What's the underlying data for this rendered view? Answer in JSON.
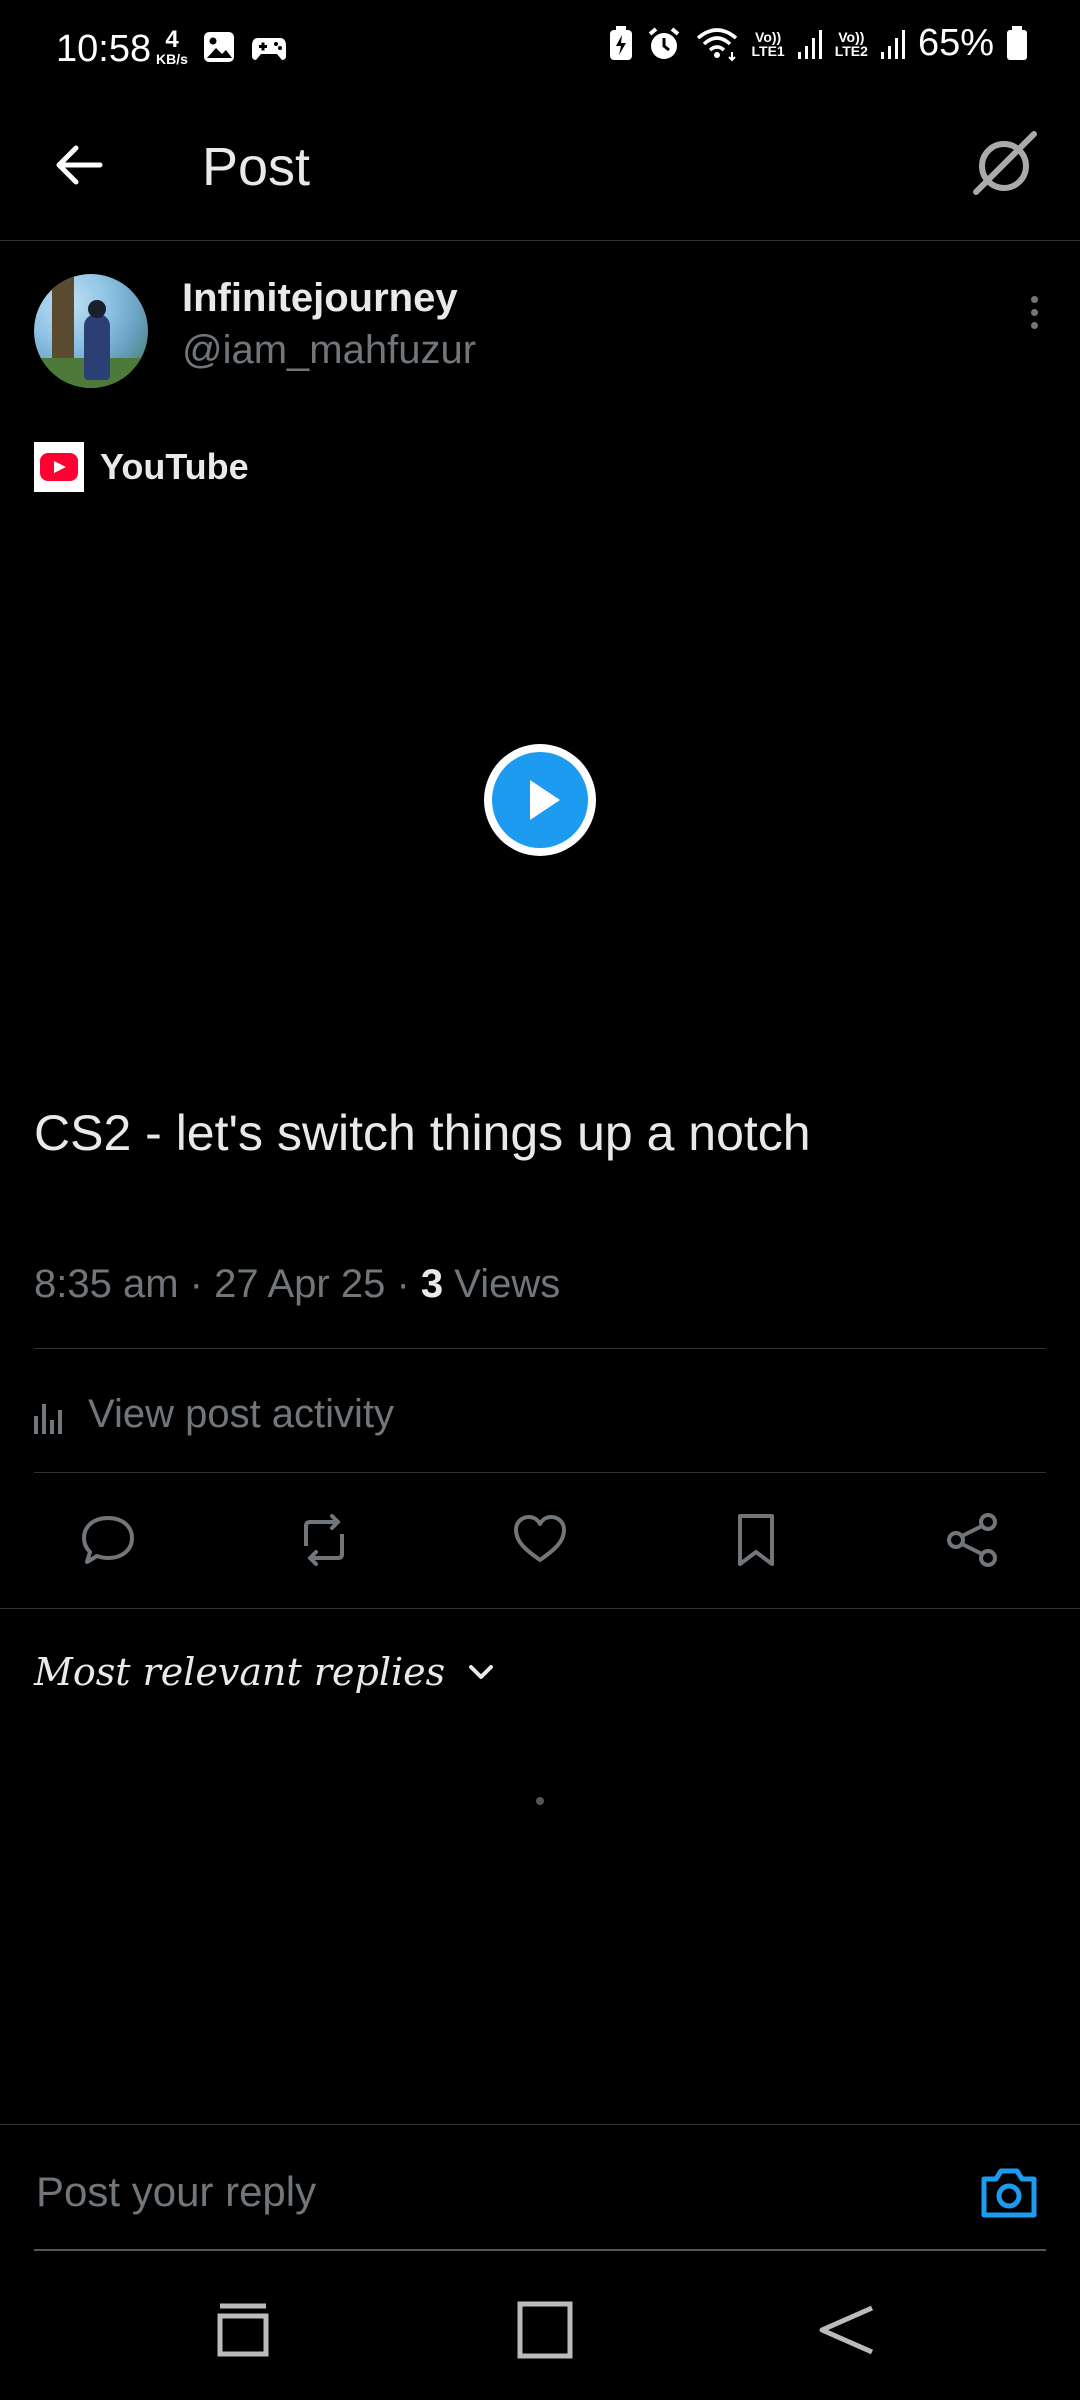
{
  "status_bar": {
    "time": "10:58",
    "net_speed_value": "4",
    "net_speed_unit": "KB/s",
    "sim1": "Vo))\nLTE1",
    "sim2": "Vo))\nLTE2",
    "battery": "65%"
  },
  "header": {
    "title": "Post"
  },
  "author": {
    "display_name": "Infinitejourney",
    "handle": "@iam_mahfuzur"
  },
  "card": {
    "source": "YouTube"
  },
  "post": {
    "text": "CS2 - let's switch things up a notch",
    "time": "8:35 am",
    "date": "27 Apr 25",
    "views_count": "3",
    "views_label": "Views"
  },
  "activity": {
    "label": "View post activity"
  },
  "replies": {
    "sort_label": "Most relevant replies"
  },
  "reply_bar": {
    "placeholder": "Post your reply"
  },
  "colors": {
    "accent": "#1d9bf0",
    "background": "#000000",
    "text_primary": "#e7e9ea",
    "text_secondary": "#71767b",
    "divider": "#2f3336",
    "youtube_red": "#ff0033"
  },
  "icons": {
    "back": "arrow-left-icon",
    "grok": "grok-icon",
    "more": "more-vertical-icon",
    "play": "play-icon",
    "activity": "bar-chart-icon",
    "reply": "comment-icon",
    "repost": "repost-icon",
    "like": "heart-icon",
    "bookmark": "bookmark-icon",
    "share": "share-icon",
    "camera": "camera-icon"
  }
}
